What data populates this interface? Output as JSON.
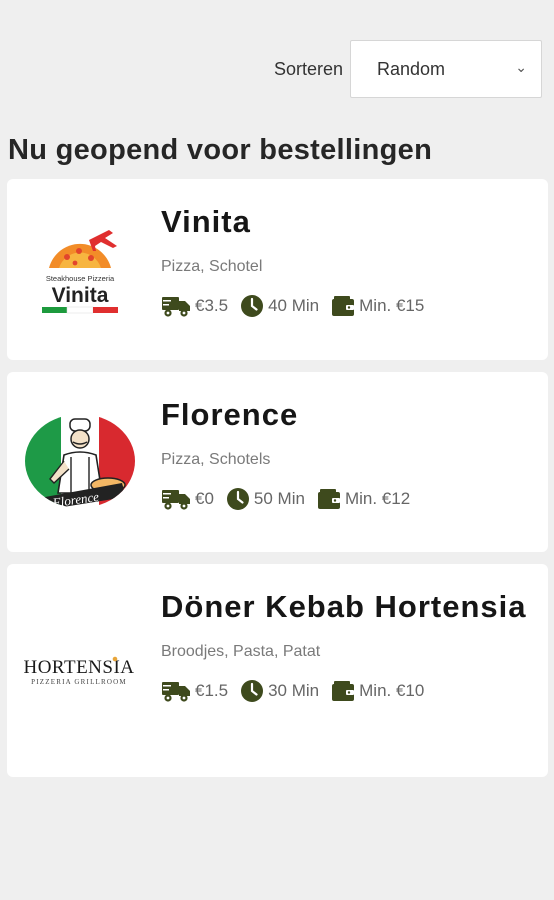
{
  "sort": {
    "label": "Sorteren",
    "selected": "Random"
  },
  "section_title": "Nu geopend voor bestellingen",
  "colors": {
    "icon": "#3e4a1d",
    "background": "#efefef",
    "card": "#ffffff"
  },
  "restaurants": [
    {
      "name": "Vinita",
      "categories": "Pizza, Schotel",
      "delivery_cost": "€3.5",
      "delivery_time": "40 Min",
      "min_order": "Min. €15",
      "logo": {
        "tagline": "Steakhouse Pizzeria",
        "brand": "Vinita"
      }
    },
    {
      "name": "Florence",
      "categories": "Pizza, Schotels",
      "delivery_cost": "€0",
      "delivery_time": "50 Min",
      "min_order": "Min. €12",
      "logo": {
        "brand": "Florence"
      }
    },
    {
      "name": "Döner Kebab Hortensia",
      "categories": "Broodjes, Pasta, Patat",
      "delivery_cost": "€1.5",
      "delivery_time": "30 Min",
      "min_order": "Min. €10",
      "logo": {
        "brand": "HORTENSIA",
        "tagline": "PIZZERIA GRILLROOM"
      }
    }
  ]
}
